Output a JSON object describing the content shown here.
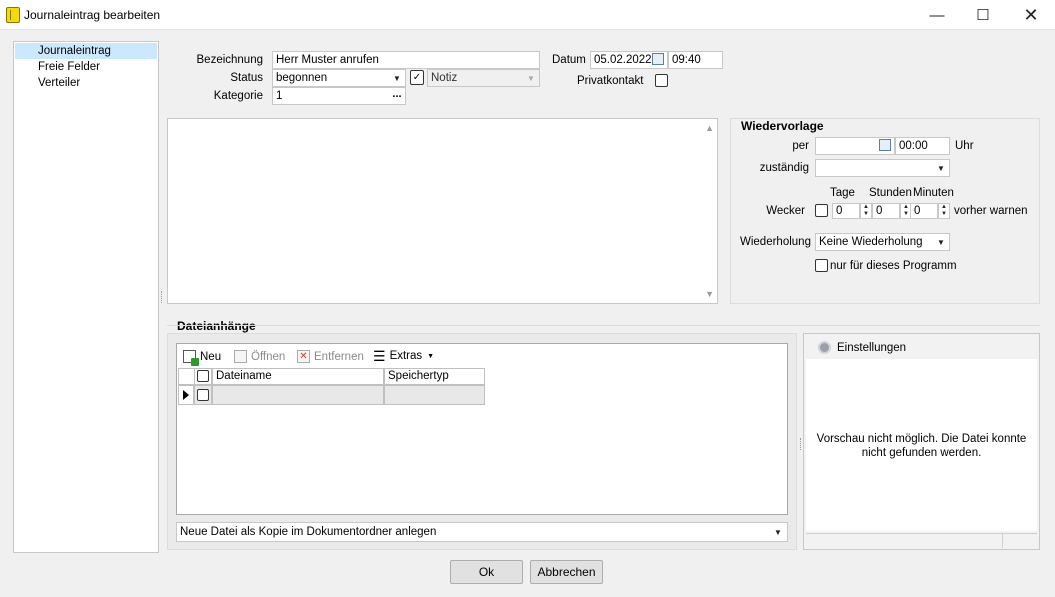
{
  "window": {
    "title": "Journaleintrag bearbeiten",
    "minimize_glyph": "—",
    "maximize_glyph": "☐",
    "close_glyph": "✕"
  },
  "nav": {
    "items": [
      {
        "label": "Journaleintrag",
        "selected": true
      },
      {
        "label": "Freie Felder",
        "selected": false
      },
      {
        "label": "Verteiler",
        "selected": false
      }
    ]
  },
  "form": {
    "bezeichnung_label": "Bezeichnung",
    "bezeichnung_value": "Herr Muster anrufen",
    "status_label": "Status",
    "status_value": "begonnen",
    "notiz_value": "Notiz",
    "notiz_checked": true,
    "kategorie_label": "Kategorie",
    "kategorie_value": "1",
    "kategorie_button": "...",
    "datum_label": "Datum",
    "datum_value": "05.02.2022",
    "time_value": "09:40",
    "privatkontakt_label": "Privatkontakt"
  },
  "wiedervorlage": {
    "title": "Wiedervorlage",
    "per_label": "per",
    "per_time": "00:00",
    "uhr_label": "Uhr",
    "zustaendig_label": "zuständig",
    "tage_label": "Tage",
    "stunden_label": "Stunden",
    "minuten_label": "Minuten",
    "wecker_label": "Wecker",
    "tage_value": "0",
    "stunden_value": "0",
    "minuten_value": "0",
    "vorher_label": "vorher warnen",
    "wiederholung_label": "Wiederholung",
    "wiederholung_value": "Keine Wiederholung",
    "nur_programm_label": "nur für dieses Programm"
  },
  "attachments": {
    "title": "Dateianhänge",
    "toolbar": {
      "neu": "Neu",
      "oeffnen": "Öffnen",
      "entfernen": "Entfernen",
      "extras": "Extras"
    },
    "columns": [
      "Dateiname",
      "Speichertyp"
    ],
    "mode_value": "Neue Datei als Kopie im Dokumentordner anlegen"
  },
  "preview": {
    "settings_label": "Einstellungen",
    "message": "Vorschau nicht möglich. Die Datei konnte nicht gefunden werden."
  },
  "buttons": {
    "ok": "Ok",
    "cancel": "Abbrechen"
  },
  "colors": {
    "nav_selected": "#cce8ff",
    "new_icon_green": "#2e9a2e",
    "delete_icon_red": "#c94040"
  }
}
